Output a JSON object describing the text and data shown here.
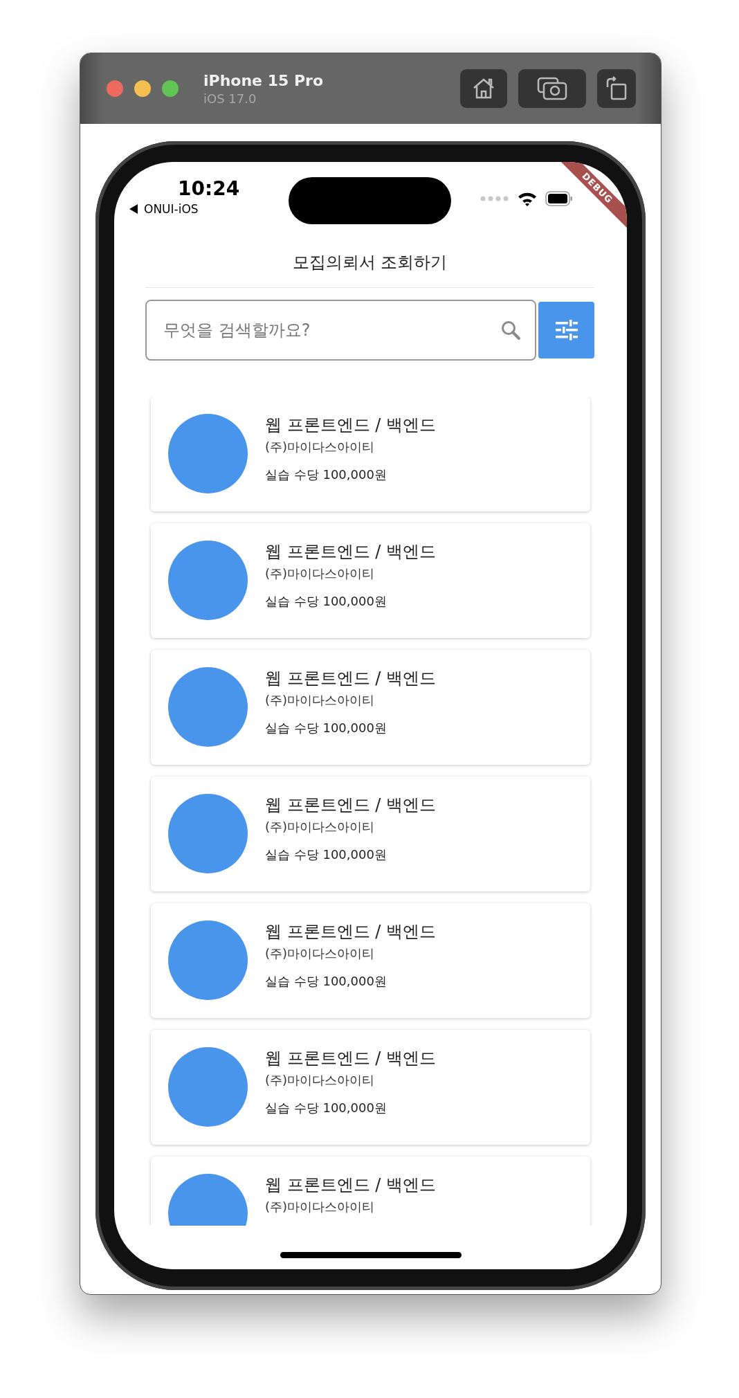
{
  "simulator": {
    "device": "iPhone 15 Pro",
    "os": "iOS 17.0"
  },
  "status_bar": {
    "time": "10:24",
    "back_app": "ONUI-iOS"
  },
  "debug_banner": "DEBUG",
  "header": {
    "title": "모집의뢰서 조회하기"
  },
  "search": {
    "placeholder": "무엇을 검색할까요?"
  },
  "postings": [
    {
      "title": "웹 프론트엔드 / 백엔드",
      "company": "(주)마이다스아이티",
      "wage": "실습 수당 100,000원"
    },
    {
      "title": "웹 프론트엔드 / 백엔드",
      "company": "(주)마이다스아이티",
      "wage": "실습 수당 100,000원"
    },
    {
      "title": "웹 프론트엔드 / 백엔드",
      "company": "(주)마이다스아이티",
      "wage": "실습 수당 100,000원"
    },
    {
      "title": "웹 프론트엔드 / 백엔드",
      "company": "(주)마이다스아이티",
      "wage": "실습 수당 100,000원"
    },
    {
      "title": "웹 프론트엔드 / 백엔드",
      "company": "(주)마이다스아이티",
      "wage": "실습 수당 100,000원"
    },
    {
      "title": "웹 프론트엔드 / 백엔드",
      "company": "(주)마이다스아이티",
      "wage": "실습 수당 100,000원"
    },
    {
      "title": "웹 프론트엔드 / 백엔드",
      "company": "(주)마이다스아이티"
    }
  ]
}
